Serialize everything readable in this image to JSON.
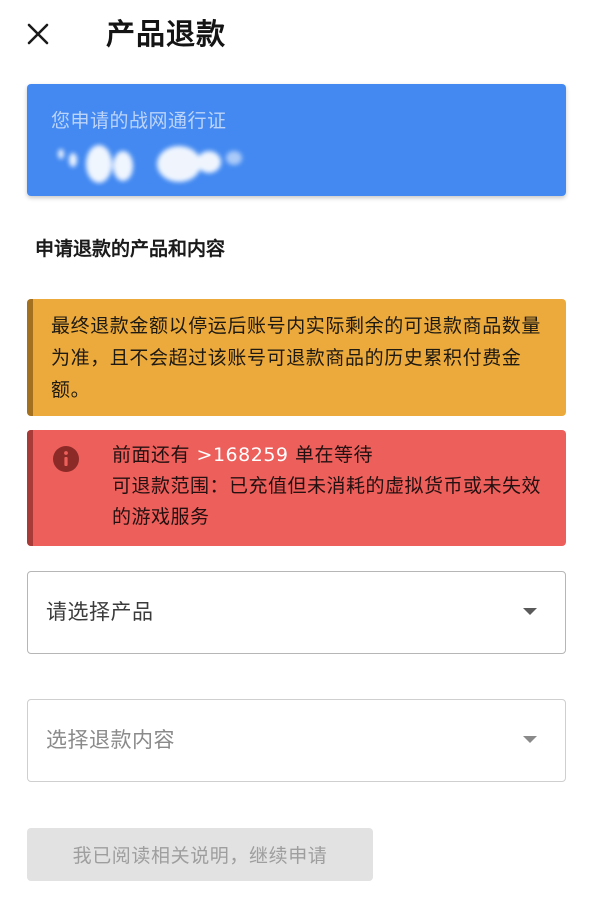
{
  "header": {
    "close_icon": "close-icon",
    "title": "产品退款"
  },
  "pass_card": {
    "label": "您申请的战网通行证",
    "background_color": "#4389f1"
  },
  "section_title": "申请退款的产品和内容",
  "notice_warning": {
    "text": "最终退款金额以停运后账号内实际剩余的可退款商品数量为准，且不会超过该账号可退款商品的历史累积付费金额。",
    "color": "#ecaa3d"
  },
  "notice_queue": {
    "icon": "info-icon",
    "queue_prefix": "前面还有 ",
    "queue_count": ">168259",
    "queue_suffix": " 单在等待",
    "scope_text": "可退款范围：已充值但未消耗的虚拟货币或未失效的游戏服务",
    "color": "#ed5f5b"
  },
  "select_product": {
    "placeholder": "请选择产品"
  },
  "select_content": {
    "placeholder": "选择退款内容"
  },
  "submit_button": {
    "label": "我已阅读相关说明，继续申请"
  }
}
